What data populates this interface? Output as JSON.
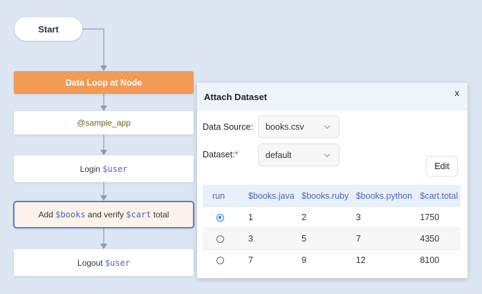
{
  "flow": {
    "start_label": "Start",
    "loop_label": "Data Loop at Node",
    "app_label": "@sample_app",
    "login": {
      "text": "Login ",
      "var": "$user"
    },
    "add": {
      "text1": "Add ",
      "var1": "$books",
      "text2": " and verify ",
      "var2": "$cart",
      "text3": " total"
    },
    "logout": {
      "text": "Logout ",
      "var": "$user"
    }
  },
  "dialog": {
    "title": "Attach Dataset",
    "close_label": "x",
    "data_source_label": "Data Source:",
    "data_source_value": "books.csv",
    "dataset_label": "Dataset:",
    "dataset_required_mark": "*",
    "dataset_value": "default",
    "edit_label": "Edit",
    "table": {
      "headers": [
        "run",
        "$books.java",
        "$books.ruby",
        "$books.python",
        "$cart.total"
      ],
      "rows": [
        {
          "selected": true,
          "cells": [
            "1",
            "2",
            "3",
            "1750"
          ]
        },
        {
          "selected": false,
          "cells": [
            "3",
            "5",
            "7",
            "4350"
          ]
        },
        {
          "selected": false,
          "cells": [
            "7",
            "9",
            "12",
            "8100"
          ]
        }
      ]
    }
  },
  "colors": {
    "background": "#dde6f3",
    "loop_node": "#f39a56",
    "selected_border": "#5a7fc8",
    "variable_text": "#4e62c9",
    "radio_accent": "#1677ff"
  }
}
